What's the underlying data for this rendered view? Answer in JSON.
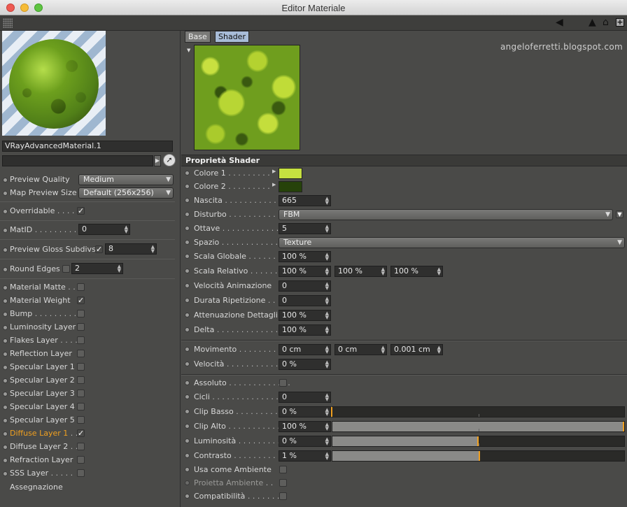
{
  "window": {
    "title": "Editor Materiale"
  },
  "watermark": "angeloferretti.blogspot.com",
  "left": {
    "material_name": "VRayAdvancedMaterial.1",
    "preview_quality": {
      "label": "Preview Quality",
      "value": "Medium"
    },
    "map_preview_size": {
      "label": "Map Preview Size",
      "value": "Default (256x256)"
    },
    "overridable": {
      "label": "Overridable",
      "leader": " . . . . ",
      "checked": true
    },
    "mat_id": {
      "label": "MatID",
      "leader": " . . . . . . . . . . ",
      "value": "0"
    },
    "preview_gloss": {
      "label": "Preview Gloss Subdivs",
      "checked": true,
      "value": "8"
    },
    "round_edges": {
      "label": "Round Edges",
      "checked": false,
      "value": "2"
    },
    "layers": [
      {
        "label": "Material Matte",
        "leader": " . . ",
        "checked": false,
        "highlight": false
      },
      {
        "label": "Material Weight",
        "leader": "",
        "checked": true,
        "highlight": false
      },
      {
        "label": "Bump",
        "leader": " . . . . . . . . . . ",
        "checked": false,
        "highlight": false
      },
      {
        "label": "Luminosity Layer",
        "leader": "",
        "checked": false,
        "highlight": false
      },
      {
        "label": "Flakes Layer",
        "leader": " . . . . ",
        "checked": false,
        "highlight": false
      },
      {
        "label": "Reflection Layer",
        "leader": "",
        "checked": false,
        "highlight": false
      },
      {
        "label": "Specular Layer 1",
        "leader": "",
        "checked": false,
        "highlight": false
      },
      {
        "label": "Specular Layer 2",
        "leader": "",
        "checked": false,
        "highlight": false
      },
      {
        "label": "Specular Layer 3",
        "leader": "",
        "checked": false,
        "highlight": false
      },
      {
        "label": "Specular Layer 4",
        "leader": "",
        "checked": false,
        "highlight": false
      },
      {
        "label": "Specular Layer 5",
        "leader": "",
        "checked": false,
        "highlight": false
      },
      {
        "label": "Diffuse Layer 1",
        "leader": " . . ",
        "checked": true,
        "highlight": true
      },
      {
        "label": "Diffuse Layer 2",
        "leader": " . . ",
        "checked": false,
        "highlight": false
      },
      {
        "label": "Refraction Layer",
        "leader": "",
        "checked": false,
        "highlight": false
      },
      {
        "label": "SSS Layer",
        "leader": " . . . . . ",
        "checked": false,
        "highlight": false
      }
    ],
    "assegnazione": "Assegnazione"
  },
  "tabs": [
    {
      "label": "Base",
      "active": false
    },
    {
      "label": "Shader",
      "active": true
    }
  ],
  "shader": {
    "section_title": "Proprietà Shader",
    "colore1": {
      "label": "Colore 1",
      "leader": " . . . . . . . . . ",
      "color": "#c6e040"
    },
    "colore2": {
      "label": "Colore 2",
      "leader": " . . . . . . . . . ",
      "color": "#26420a"
    },
    "nascita": {
      "label": "Nascita",
      "leader": " . . . . . . . . . . . . . ",
      "value": "665"
    },
    "disturbo": {
      "label": "Disturbo",
      "leader": " . . . . . . . . . . . . ",
      "value": "FBM"
    },
    "ottave": {
      "label": "Ottave",
      "leader": " . . . . . . . . . . . . . . ",
      "value": "5"
    },
    "spazio": {
      "label": "Spazio",
      "leader": " . . . . . . . . . . . . . . ",
      "value": "Texture"
    },
    "scala_globale": {
      "label": "Scala Globale",
      "leader": " . . . . . . ",
      "value": "100 %"
    },
    "scala_relativo": {
      "label": "Scala Relativo",
      "leader": " . . . . . . ",
      "values": [
        "100 %",
        "100 %",
        "100 %"
      ]
    },
    "velocita_animazione": {
      "label": "Velocità Animazione",
      "value": "0"
    },
    "durata_ripetizione": {
      "label": "Durata Ripetizione",
      "leader": " . . ",
      "value": "0"
    },
    "attenuazione_dettagli": {
      "label": "Attenuazione Dettagli",
      "value": "100 %"
    },
    "delta": {
      "label": "Delta",
      "leader": " . . . . . . . . . . . . . . . ",
      "value": "100 %"
    },
    "movimento": {
      "label": "Movimento",
      "leader": " . . . . . . . . . ",
      "values": [
        "0 cm",
        "0 cm",
        "0.001 cm"
      ]
    },
    "velocita": {
      "label": "Velocità",
      "leader": " . . . . . . . . . . . . . ",
      "value": "0 %"
    },
    "assoluto": {
      "label": "Assoluto",
      "leader": " . . . . . . . . . . . . . ",
      "checked": false
    },
    "cicli": {
      "label": "Cicli",
      "leader": " . . . . . . . . . . . . . . . . . . ",
      "value": "0"
    },
    "clip_basso": {
      "label": "Clip Basso",
      "leader": " . . . . . . . . . . ",
      "value": "0 %",
      "fraction": 0.0
    },
    "clip_alto": {
      "label": "Clip Alto",
      "leader": " . . . . . . . . . . . . ",
      "value": "100 %",
      "fraction": 1.0
    },
    "luminosita": {
      "label": "Luminosità",
      "leader": " . . . . . . . . . . ",
      "value": "0 %",
      "fraction": 0.5
    },
    "contrasto": {
      "label": "Contrasto",
      "leader": " . . . . . . . . . . . ",
      "value": "1 %",
      "fraction": 0.505
    },
    "usa_come_ambiente": {
      "label": "Usa come Ambiente",
      "checked": false
    },
    "proietta_ambiente": {
      "label": "Proietta Ambiente",
      "leader": " . . ",
      "checked": false,
      "disabled": true
    },
    "compatibilita": {
      "label": "Compatibilità",
      "leader": " . . . . . . . . ",
      "checked": false
    }
  },
  "icons": [
    "grip-icon",
    "arrow-back-icon",
    "cursor-icon",
    "lock-icon",
    "add-icon"
  ]
}
